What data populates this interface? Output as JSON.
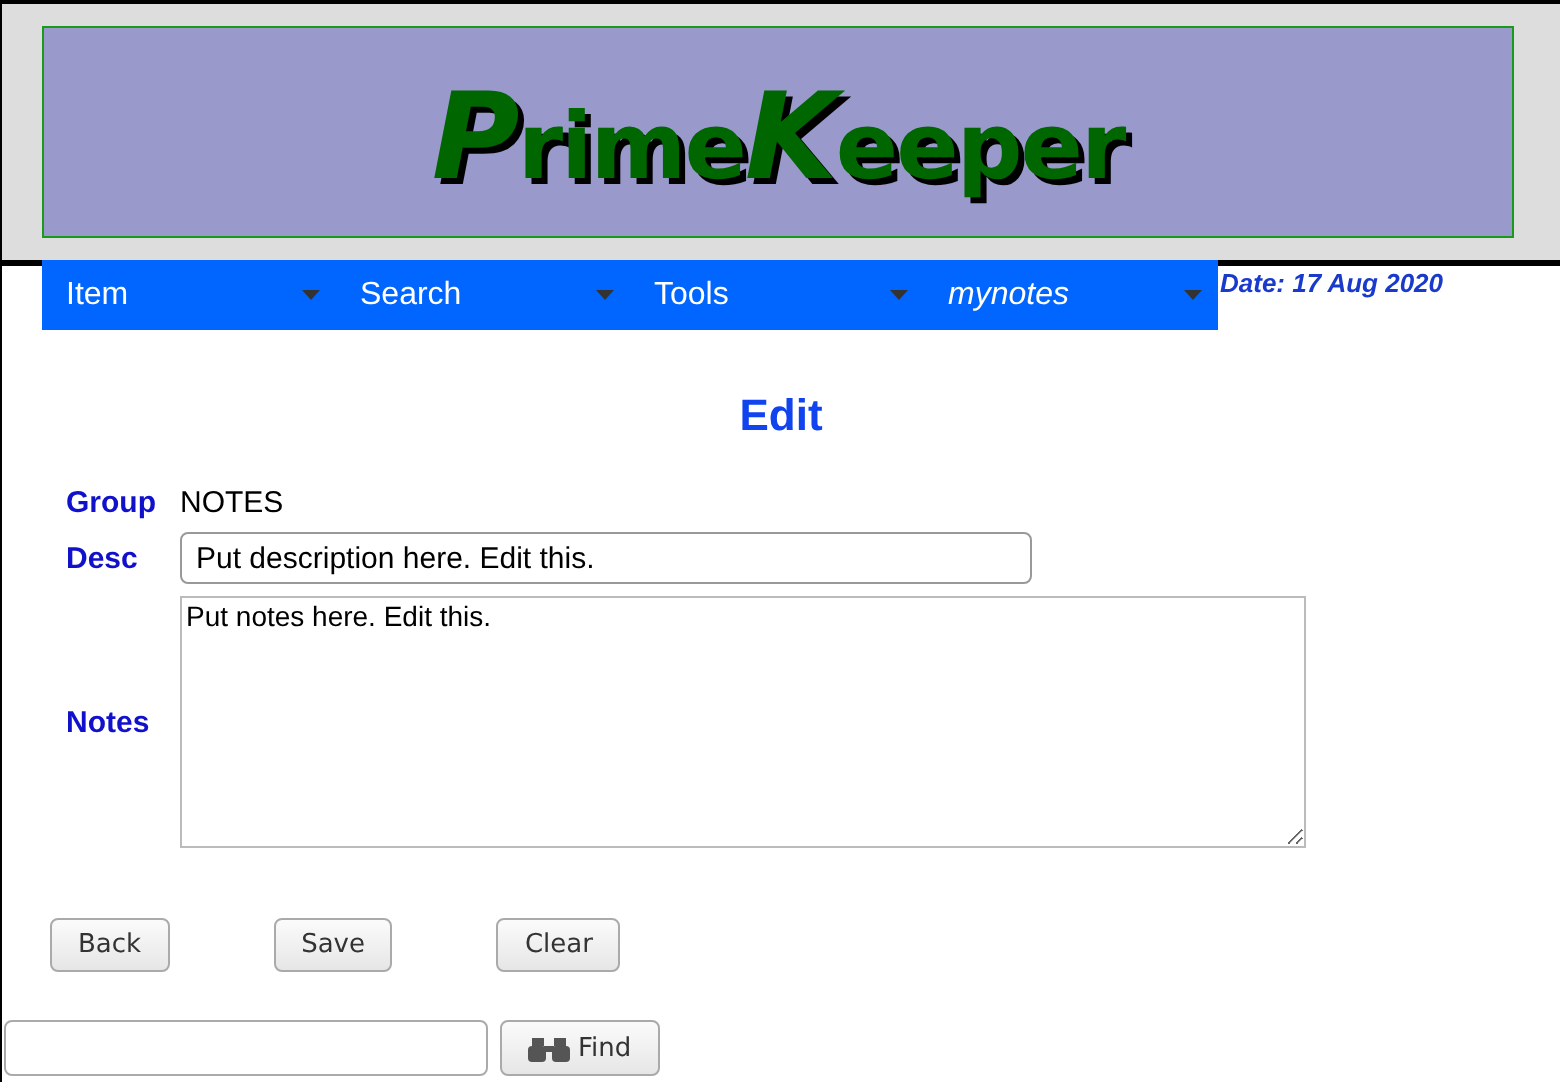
{
  "logo": [
    {
      "text": "P",
      "kind": "initial"
    },
    {
      "text": "rime",
      "kind": "rest"
    },
    {
      "text": "K",
      "kind": "initial"
    },
    {
      "text": "eeper",
      "kind": "rest"
    }
  ],
  "menu": [
    {
      "label": "Item",
      "italic": false
    },
    {
      "label": "Search",
      "italic": false
    },
    {
      "label": "Tools",
      "italic": false
    },
    {
      "label": "mynotes",
      "italic": true
    }
  ],
  "date": "Date: 17 Aug 2020",
  "heading": "Edit",
  "form": {
    "group_label": "Group",
    "group_value": "NOTES",
    "desc_label": "Desc",
    "desc_value": "Put description here. Edit this.",
    "notes_label": "Notes",
    "notes_value": "Put notes here. Edit this."
  },
  "buttons": [
    "Back",
    "Save",
    "Clear"
  ],
  "find_button": "Find"
}
